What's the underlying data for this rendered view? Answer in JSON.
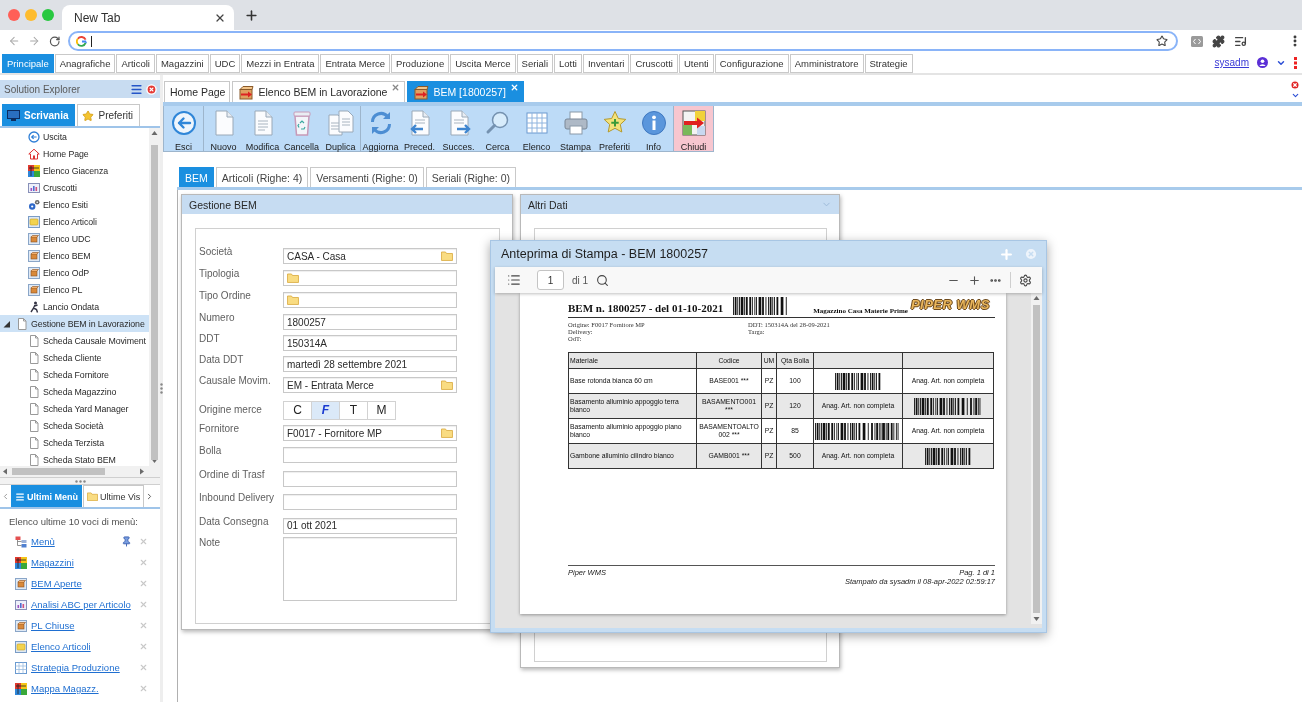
{
  "browser": {
    "tab_title": "New Tab"
  },
  "menu_bar": {
    "items": [
      {
        "label": "Principale",
        "selected": true
      },
      {
        "label": "Anagrafiche",
        "selected": false
      },
      {
        "label": "Articoli",
        "selected": false
      },
      {
        "label": "Magazzini",
        "selected": false
      },
      {
        "label": "UDC",
        "selected": false
      },
      {
        "label": "Mezzi in Entrata",
        "selected": false
      },
      {
        "label": "Entrata Merce",
        "selected": false
      },
      {
        "label": "Produzione",
        "selected": false
      },
      {
        "label": "Uscita Merce",
        "selected": false
      },
      {
        "label": "Seriali",
        "selected": false
      },
      {
        "label": "Lotti",
        "selected": false
      },
      {
        "label": "Inventari",
        "selected": false
      },
      {
        "label": "Cruscotti",
        "selected": false
      },
      {
        "label": "Utenti",
        "selected": false
      },
      {
        "label": "Configurazione",
        "selected": false
      },
      {
        "label": "Amministratore",
        "selected": false
      },
      {
        "label": "Strategie",
        "selected": false
      }
    ],
    "user": "sysadm"
  },
  "solution_explorer": {
    "title": "Solution Explorer",
    "tabs": [
      {
        "label": "Scrivania",
        "selected": true
      },
      {
        "label": "Preferiti",
        "selected": false
      }
    ],
    "tree": [
      {
        "children": [
          {
            "label": "Uscita",
            "selected": false
          },
          {
            "label": "Home Page",
            "selected": false
          },
          {
            "label": "Elenco Giacenza",
            "selected": false
          },
          {
            "label": "Cruscotti",
            "selected": false
          },
          {
            "label": "Elenco Esiti",
            "selected": false
          },
          {
            "label": "Elenco Articoli",
            "selected": false
          },
          {
            "label": "Elenco UDC",
            "selected": false
          },
          {
            "label": "Elenco BEM",
            "selected": false
          },
          {
            "label": "Elenco OdP",
            "selected": false
          },
          {
            "label": "Elenco PL",
            "selected": false
          },
          {
            "label": "Lancio Ondata",
            "selected": false
          }
        ]
      },
      {
        "label": "Gestione BEM in Lavorazione",
        "selected": true,
        "expanded": true,
        "children": [
          {
            "label": "Scheda Causale Moviment",
            "selected": false
          },
          {
            "label": "Scheda Cliente",
            "selected": false
          },
          {
            "label": "Scheda Fornitore",
            "selected": false
          },
          {
            "label": "Scheda Magazzino",
            "selected": false
          },
          {
            "label": "Scheda Yard Manager",
            "selected": false
          },
          {
            "label": "Scheda Società",
            "selected": false
          },
          {
            "label": "Scheda Terzista",
            "selected": false
          },
          {
            "label": "Scheda Stato BEM",
            "selected": false
          }
        ]
      }
    ]
  },
  "recent_panel": {
    "tabs": [
      {
        "label": "Ultimi Menù",
        "selected": true
      },
      {
        "label": "Ultime Vis",
        "selected": false
      }
    ],
    "heading": "Elenco ultime 10 voci di menù:",
    "links": [
      {
        "label": "Menù",
        "pinned": true
      },
      {
        "label": "Magazzini",
        "pinned": false
      },
      {
        "label": "BEM Aperte",
        "pinned": false
      },
      {
        "label": "Analisi ABC per Articolo",
        "pinned": false
      },
      {
        "label": "PL Chiuse",
        "pinned": false
      },
      {
        "label": "Elenco Articoli",
        "pinned": false
      },
      {
        "label": "Strategia Produzione",
        "pinned": false
      },
      {
        "label": "Mappa Magazz.",
        "pinned": false
      }
    ]
  },
  "document_tabs": [
    {
      "label": "Home Page",
      "kind": "page",
      "selected": false
    },
    {
      "label": "Elenco BEM in Lavorazione",
      "kind": "form",
      "selected": false
    },
    {
      "label": "BEM [1800257]",
      "kind": "form",
      "selected": true
    }
  ],
  "toolbar": {
    "groups": [
      {
        "kind": "default",
        "buttons": [
          "Esci"
        ]
      },
      {
        "kind": "default",
        "buttons": [
          "Nuovo",
          "Modifica",
          "Cancella",
          "Duplica"
        ]
      },
      {
        "kind": "default",
        "buttons": [
          "Aggiorna",
          "Preced.",
          "Succes.",
          "Cerca",
          "Elenco",
          "Stampa",
          "Preferiti",
          "Info"
        ]
      },
      {
        "kind": "close",
        "buttons": [
          "Chiudi"
        ]
      }
    ]
  },
  "form_tabs": [
    {
      "label": "BEM",
      "selected": true
    },
    {
      "label": "Articoli (Righe: 4)",
      "selected": false
    },
    {
      "label": "Versamenti (Righe: 0)",
      "selected": false
    },
    {
      "label": "Seriali (Righe: 0)",
      "selected": false
    }
  ],
  "gestione_panel": {
    "title": "Gestione BEM",
    "fields": [
      {
        "kind": "lookup",
        "label": "Società",
        "value": "CASA - Casa"
      },
      {
        "kind": "lookup",
        "label": "Tipologia"
      },
      {
        "kind": "lookup",
        "label": "Tipo Ordine"
      },
      {
        "kind": "text",
        "label": "Numero",
        "value": "1800257"
      },
      {
        "kind": "text",
        "label": "DDT",
        "value": "150314A"
      },
      {
        "kind": "text",
        "label": "Data DDT",
        "value": "martedì 28 settembre 2021"
      },
      {
        "kind": "lookup",
        "label": "Causale Movim.",
        "value": "EM - Entrata Merce"
      },
      {
        "kind": "toggle",
        "label": "Origine merce",
        "options": [
          {
            "label": "C",
            "selected": false
          },
          {
            "label": "F",
            "selected": true
          },
          {
            "label": "T",
            "selected": false
          },
          {
            "label": "M",
            "selected": false
          }
        ]
      },
      {
        "kind": "lookup",
        "label": "Fornitore",
        "value": "F0017 - Fornitore MP"
      },
      {
        "kind": "text",
        "label": "Bolla"
      },
      {
        "kind": "text",
        "label": "Ordine di Trasf"
      },
      {
        "kind": "text",
        "label": "Inbound Delivery"
      },
      {
        "kind": "text",
        "label": "Data Consegna",
        "value": "01 ott 2021"
      },
      {
        "kind": "area",
        "label": "Note"
      }
    ]
  },
  "altri_dati_panel": {
    "title": "Altri Dati"
  },
  "print_preview": {
    "title": "Anteprima di Stampa - BEM 1800257",
    "page": "1",
    "page_count": "di 1",
    "document": {
      "title": "BEM n. 1800257 - del 01-10-2021",
      "warehouse": "Magazzino Casa Materie Prime",
      "logo": "PIPER WMS",
      "info_left": [
        "Origine: F0017 Fornitore MP",
        "Delivery:",
        "OdT:"
      ],
      "info_right": [
        "DDT: 150314A del 28-09-2021",
        "Targa:"
      ],
      "table": {
        "columns": [
          "Materiale",
          "Codice",
          "UM",
          "Qta Bolla"
        ],
        "rows": [
          {
            "materiale": "Base rotonda bianca 60 cm",
            "codice": "BASE001 ***",
            "um": "PZ",
            "qta_bolla": "100",
            "column_5": {
              "kind": "barcode"
            },
            "column_6": {
              "kind": "text",
              "text": "Anag. Art. non completa"
            }
          },
          {
            "materiale": "Basamento alluminio appoggio terra bianco",
            "codice": "BASAMENTO001 ***",
            "um": "PZ",
            "qta_bolla": "120",
            "column_5": {
              "kind": "text",
              "text": "Anag. Art. non completa"
            },
            "column_6": {
              "kind": "barcode"
            }
          },
          {
            "materiale": "Basamento alluminio appoggio piano bianco",
            "codice": "BASAMENTOALTO002 ***",
            "um": "PZ",
            "qta_bolla": "85",
            "column_5": {
              "kind": "barcode"
            },
            "column_6": {
              "kind": "text",
              "text": "Anag. Art. non completa"
            }
          },
          {
            "materiale": "Gambone alluminio cilindro bianco",
            "codice": "GAMB001 ***",
            "um": "PZ",
            "qta_bolla": "500",
            "column_5": {
              "kind": "text",
              "text": "Anag. Art. non completa"
            },
            "column_6": {
              "kind": "barcode"
            }
          }
        ]
      },
      "footer_left": "Piper WMS",
      "footer_right": [
        "Pag. 1 di 1",
        "Stampato da sysadm il 08-apr-2022 02:59:17"
      ]
    }
  }
}
